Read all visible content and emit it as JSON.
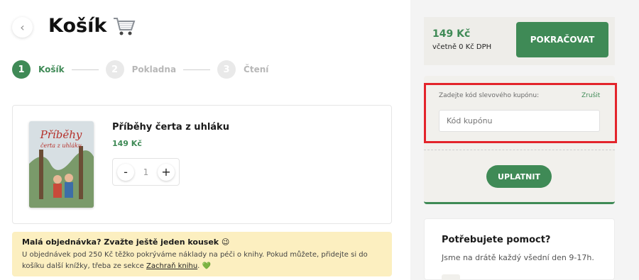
{
  "header": {
    "title": "Košík",
    "cart_icon": "shopping-cart-emoji"
  },
  "steps": [
    {
      "number": "1",
      "label": "Košík",
      "active": true
    },
    {
      "number": "2",
      "label": "Pokladna",
      "active": false
    },
    {
      "number": "3",
      "label": "Čtení",
      "active": false
    }
  ],
  "cart_item": {
    "title": "Příběhy čerta z uhláku",
    "price": "149 Kč",
    "quantity": "1",
    "cover_text": "Příběhy čerta z uhláku",
    "minus_label": "-",
    "plus_label": "+"
  },
  "notice": {
    "title": "Malá objednávka? Zvažte ještě jeden kousek 😉",
    "text_before": "U objednávek pod 250 Kč těžko pokrýváme náklady na péči o knihy. Pokud můžete, přidejte si do košíku další knížky, třeba ze sekce ",
    "link": "Zachraň knihu",
    "text_after": ". ",
    "heart": "💚"
  },
  "summary": {
    "total": "149 Kč",
    "vat": "včetně 0 Kč DPH",
    "continue_label": "POKRAČOVAT"
  },
  "coupon": {
    "label": "Zadejte kód slevového kupónu:",
    "cancel": "Zrušit",
    "placeholder": "Kód kupónu",
    "apply_label": "UPLATNIT"
  },
  "help": {
    "title": "Potřebujete pomoct?",
    "text": "Jsme na drátě každý všední den 9-17h."
  },
  "colors": {
    "accent_green": "#3f8a56",
    "notice_bg": "#fcefc0",
    "highlight_red": "#e3242b"
  }
}
